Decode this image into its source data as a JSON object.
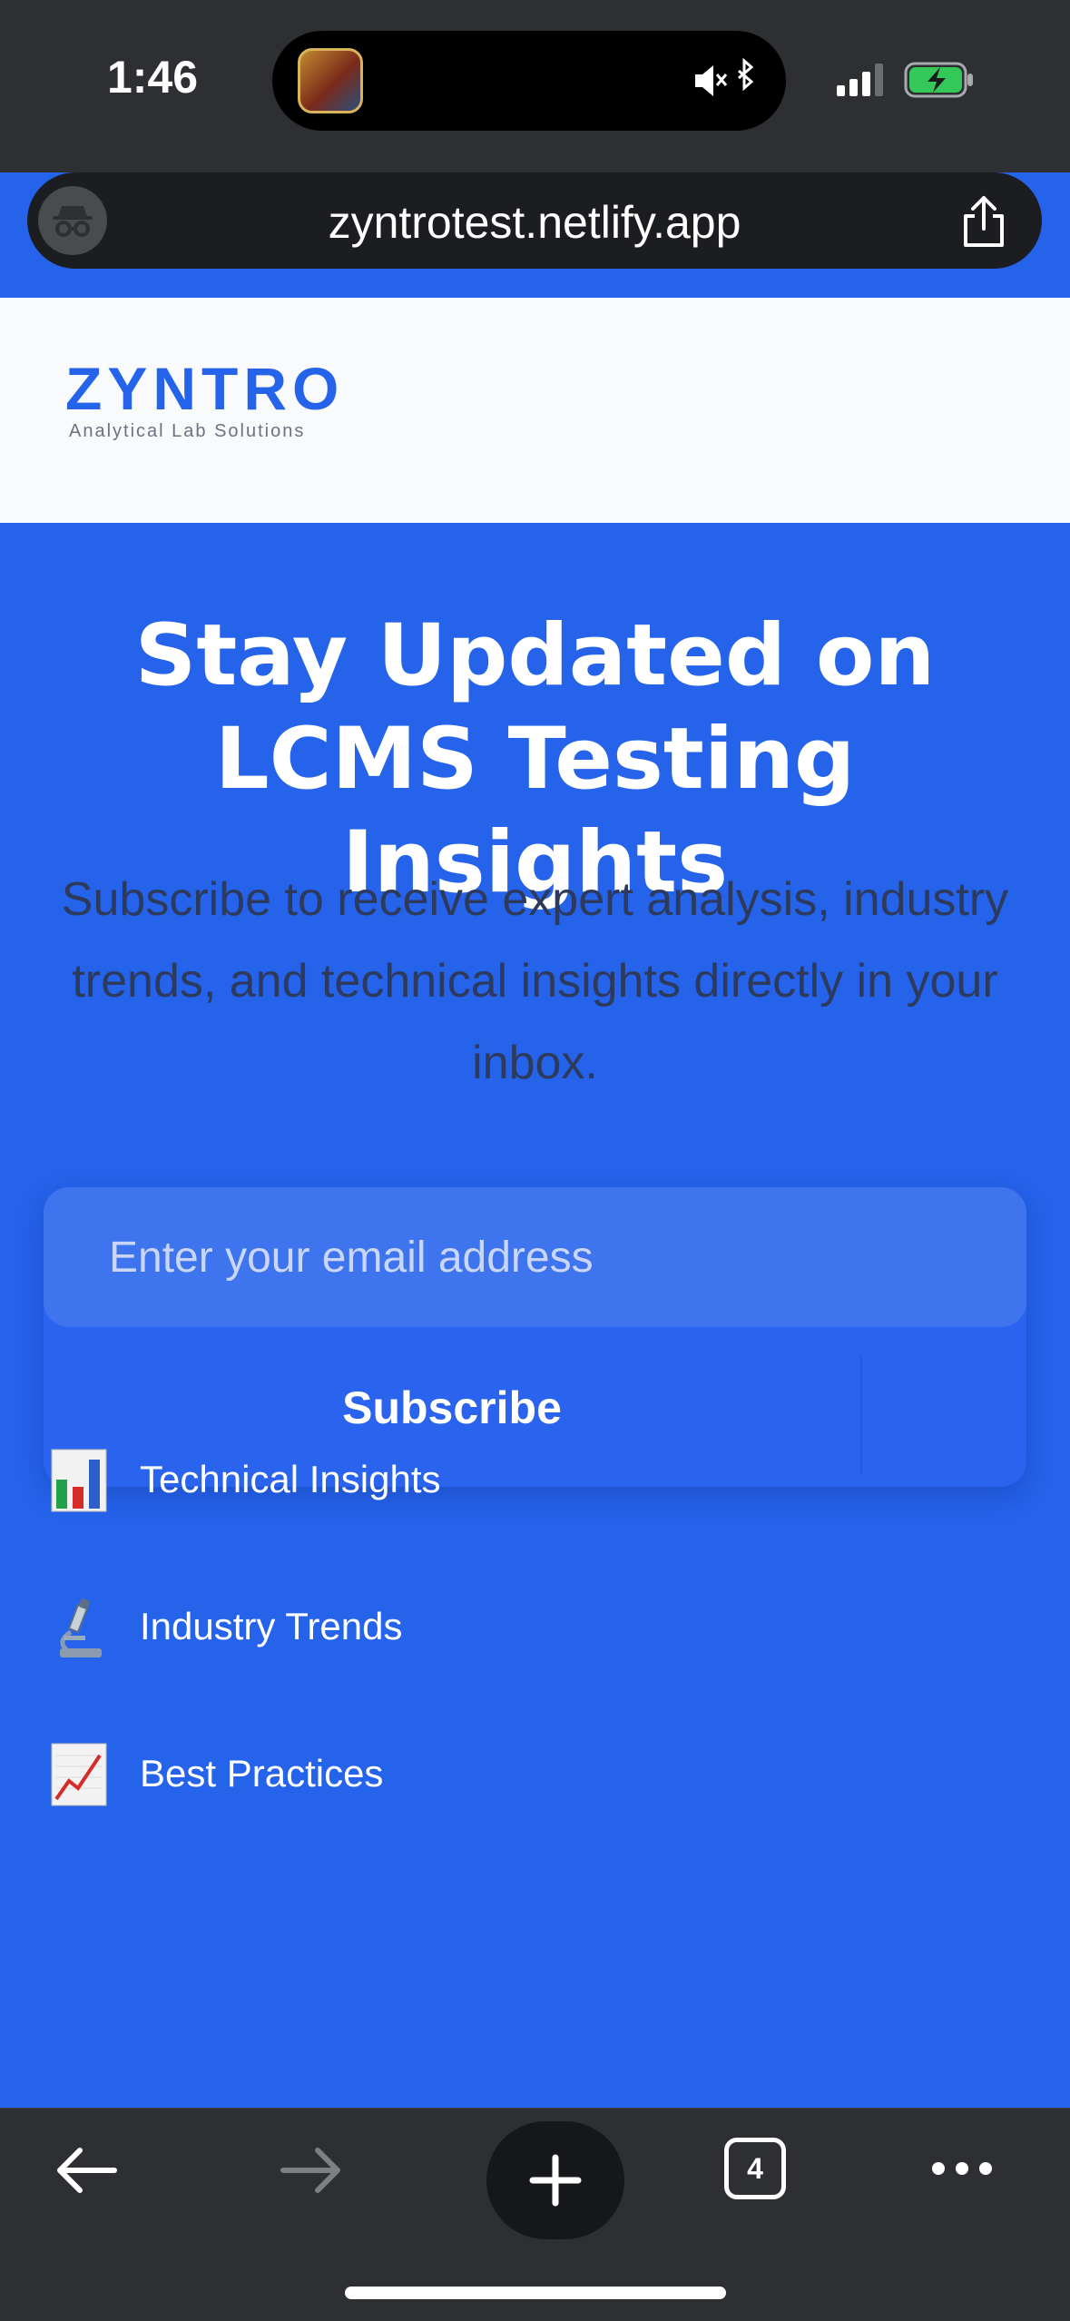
{
  "status_bar": {
    "time": "1:46",
    "island_icons": [
      "app-icon",
      "mute-icon",
      "bluetooth-icon"
    ],
    "right_icons": [
      "signal-icon",
      "battery-charging-icon"
    ]
  },
  "browser": {
    "url": "zyntrotest.netlify.app",
    "icons": [
      "privacy-mask-icon",
      "share-icon"
    ]
  },
  "site": {
    "logo": "ZYNTRO",
    "tagline": "Analytical Lab Solutions"
  },
  "hero": {
    "headline": "Stay Updated on LCMS Testing Insights",
    "subtext": "Subscribe to receive expert analysis, industry trends, and technical insights directly in your inbox."
  },
  "form": {
    "email_placeholder": "Enter your email address",
    "subscribe_label": "Subscribe"
  },
  "features": [
    {
      "icon": "bar-chart-icon",
      "label": "Technical Insights"
    },
    {
      "icon": "microscope-icon",
      "label": "Industry Trends"
    },
    {
      "icon": "trend-chart-icon",
      "label": "Best Practices"
    }
  ],
  "toolbar": {
    "tab_count": "4",
    "icons": [
      "back-icon",
      "forward-icon",
      "new-tab-icon",
      "tabs-icon",
      "more-icon"
    ]
  },
  "colors": {
    "brand_blue": "#2563eb",
    "chrome_dark": "#2d2f33",
    "header_bg": "#f9fafc"
  }
}
